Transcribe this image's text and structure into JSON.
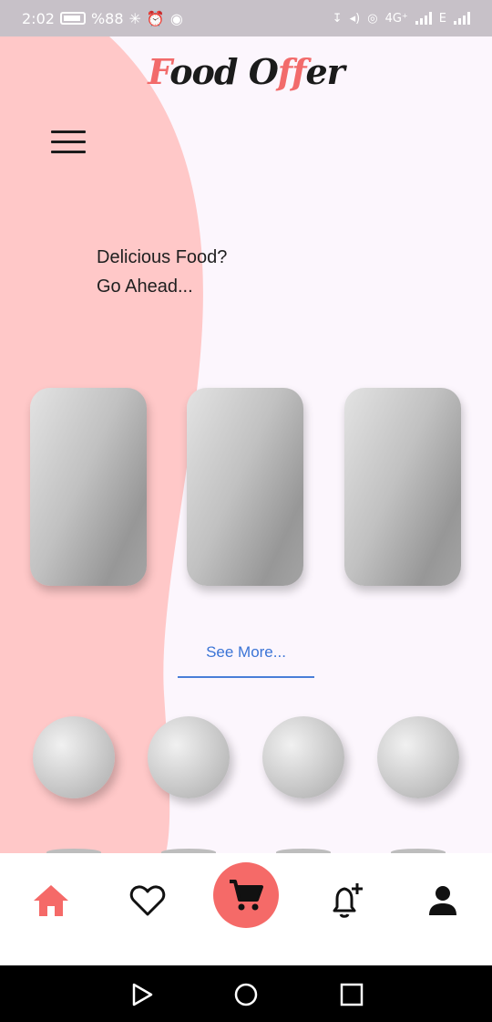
{
  "status_bar": {
    "time": "2:02",
    "battery": "%88",
    "network_4g": "4G⁺",
    "network_e": "E"
  },
  "app": {
    "logo_part1": "F",
    "logo_part2": "ood O",
    "logo_part3": "ff",
    "logo_part4": "er",
    "tagline_line1": "Delicious Food?",
    "tagline_line2": "Go Ahead...",
    "see_more": "See More..."
  },
  "colors": {
    "accent": "#f56a68",
    "wave": "#ffc8c8",
    "background": "#fcf6fd",
    "link": "#3b74d6"
  },
  "bottom_nav": {
    "items": [
      "home-icon",
      "heart-icon",
      "cart-icon",
      "bell-plus-icon",
      "user-icon"
    ],
    "active": "home-icon"
  },
  "system_nav": [
    "back-icon",
    "home-circle-icon",
    "recents-icon"
  ]
}
